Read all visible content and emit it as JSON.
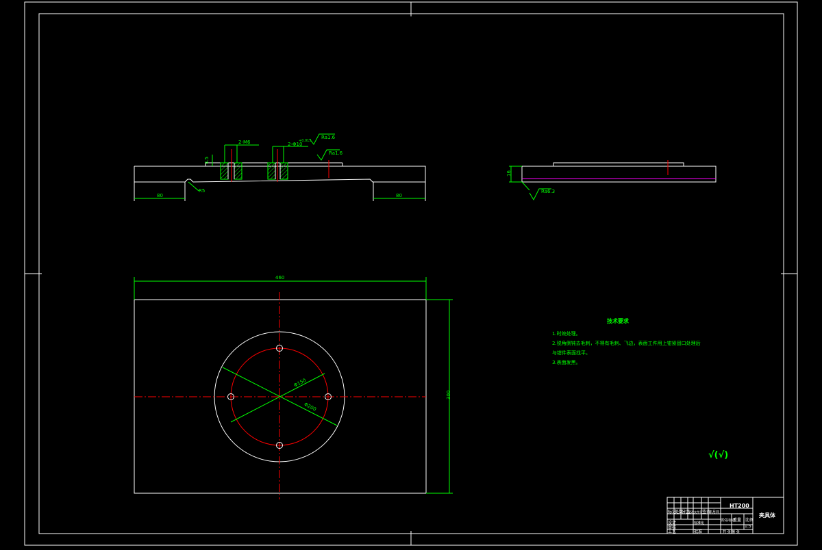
{
  "colors": {
    "background": "#000000",
    "outline": "#ffffff",
    "dimension": "#00ff00",
    "centerline": "#ff0000",
    "section": "#ff00ff"
  },
  "front_view": {
    "dim_left": "80",
    "dim_right": "80",
    "dim_radius": "R5",
    "dim_height": "4.5",
    "label_hole_left": "2-M6",
    "label_hole_right": "2-Φ10",
    "label_tolerance": "+0.015",
    "roughness_1": "Ra1.6",
    "roughness_2": "Ra1.6"
  },
  "side_view": {
    "dim_height": "16",
    "roughness": "Ra6.3"
  },
  "top_view": {
    "dim_width": "460",
    "dim_height": "300",
    "dim_diameter_1": "Φ150",
    "dim_diameter_2": "Φ200"
  },
  "tech_requirements": {
    "title": "技术要求",
    "lines": [
      "1.时效处理。",
      "2.锐角倒钝去毛刺，不得有毛刺、飞边，表面工件用上钳紧固口处理后",
      "与钳件表面找平。",
      "3.表面发黑。"
    ]
  },
  "surface_symbol": "√(√)",
  "title_block": {
    "material": "HT200",
    "part_name": "夹具体",
    "cells": [
      "标记",
      "处数",
      "分区",
      "更改文件号",
      "签名",
      "年月日",
      "设计",
      "标准化",
      "阶段标记",
      "重量",
      "比例",
      "审核",
      "工艺",
      "批准",
      "共 张 第 张",
      "1:5"
    ]
  }
}
